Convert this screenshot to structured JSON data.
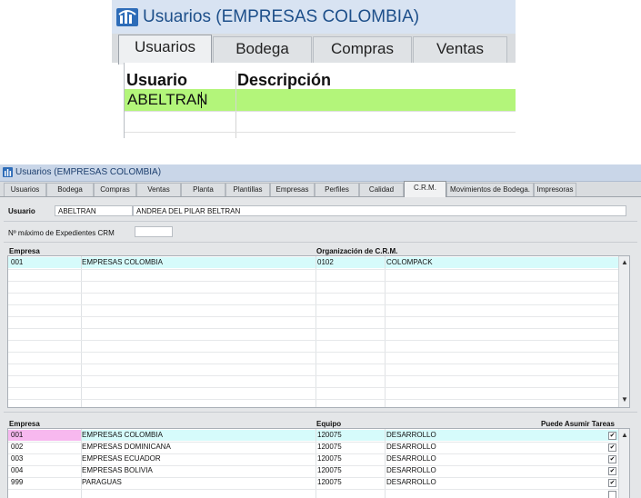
{
  "zoom": {
    "title": "Usuarios (EMPRESAS COLOMBIA)",
    "tabs": [
      "Usuarios",
      "Bodega",
      "Compras",
      "Ventas"
    ],
    "columns": [
      "Usuario",
      "Descripción"
    ],
    "row_value": "ABELTRAN"
  },
  "window": {
    "title": "Usuarios (EMPRESAS COLOMBIA)",
    "tabs": [
      "Usuarios",
      "Bodega",
      "Compras",
      "Ventas",
      "Planta",
      "Plantillas",
      "Empresas",
      "Perfiles",
      "Calidad",
      "C.R.M.",
      "Movimientos de Bodega.",
      "Impresoras"
    ],
    "active_tab": "C.R.M."
  },
  "form": {
    "usuario_label": "Usuario",
    "usuario_code": "ABELTRAN",
    "usuario_name": "ANDREA DEL PILAR BELTRAN",
    "max_exp_label": "Nº máximo de Expedientes CRM",
    "max_exp_value": ""
  },
  "grid1": {
    "headers": [
      "Empresa",
      "Organización de C.R.M."
    ],
    "rows": [
      {
        "code": "001",
        "name": "EMPRESAS COLOMBIA",
        "org_code": "0102",
        "org_name": "COLOMPACK"
      }
    ]
  },
  "grid2": {
    "headers": [
      "Empresa",
      "Equipo",
      "Puede Asumir Tareas"
    ],
    "rows": [
      {
        "code": "001",
        "name": "EMPRESAS COLOMBIA",
        "team_code": "120075",
        "team_name": "DESARROLLO",
        "checked": true
      },
      {
        "code": "002",
        "name": "EMPRESAS DOMINICANA",
        "team_code": "120075",
        "team_name": "DESARROLLO",
        "checked": true
      },
      {
        "code": "003",
        "name": "EMPRESAS ECUADOR",
        "team_code": "120075",
        "team_name": "DESARROLLO",
        "checked": true
      },
      {
        "code": "004",
        "name": "EMPRESAS BOLIVIA",
        "team_code": "120075",
        "team_name": "DESARROLLO",
        "checked": true
      },
      {
        "code": "999",
        "name": "PARAGUAS",
        "team_code": "120075",
        "team_name": "DESARROLLO",
        "checked": true
      }
    ]
  },
  "colors": {
    "title_text": "#1d4f8a",
    "selected_row_green": "#b3f57a",
    "selected_row_cyan": "#d6fbfb",
    "focus_cell_pink": "#f7b8ef"
  }
}
